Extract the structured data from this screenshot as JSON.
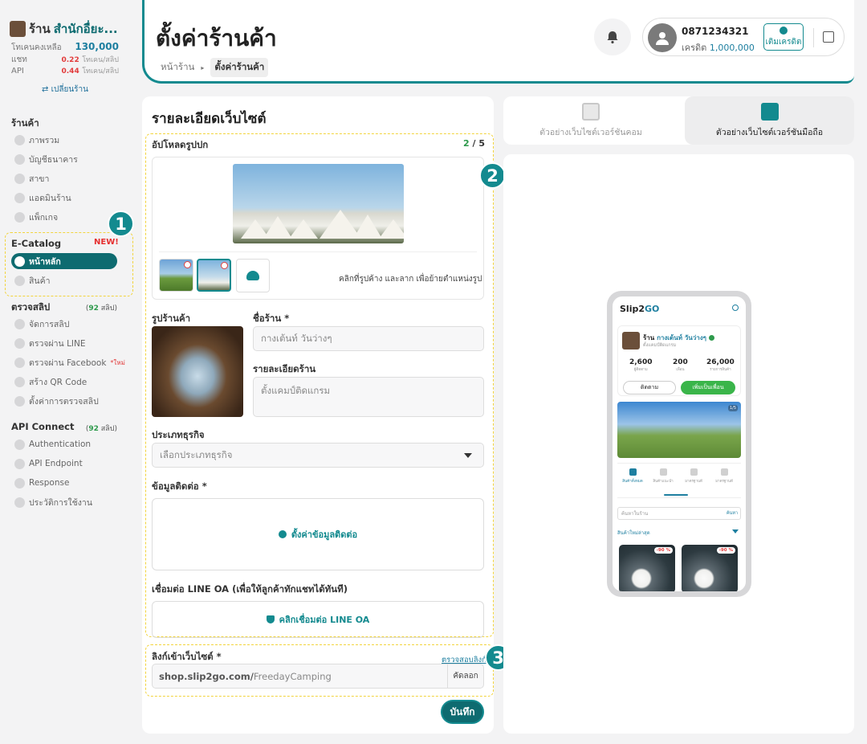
{
  "sidebar": {
    "shop_prefix": "ร้าน",
    "shop_name": "สำนักอื่ยะ...",
    "token_label": "โทเคนคงเหลือ",
    "token_value": "130,000",
    "chat_label": "แชท",
    "chat_rate": "0.22",
    "chat_unit": "โทเคน/สลิป",
    "api_label": "API",
    "api_rate": "0.44",
    "api_unit": "โทเคน/สลิป",
    "switch_shop": "⇄ เปลี่ยนร้าน",
    "section_shop": "ร้านค้า",
    "shop_items": [
      "ภาพรวม",
      "บัญชีธนาคาร",
      "สาขา",
      "แอดมินร้าน",
      "แพ็กเกจ"
    ],
    "section_ecatalog": "E-Catalog",
    "new_badge": "NEW!",
    "ecatalog_items": [
      "หน้าหลัก",
      "สินค้า"
    ],
    "section_verify": "ตรวจสลิป",
    "verify_count_prefix": "(",
    "verify_count": "92",
    "verify_count_suffix": "สลิป)",
    "verify_items": [
      "จัดการสลิป",
      "ตรวจผ่าน LINE",
      "ตรวจผ่าน Facebook",
      "สร้าง QR Code",
      "ตั้งค่าการตรวจสลิป"
    ],
    "facebook_new": "*ใหม่",
    "section_api": "API Connect",
    "api_count": "92",
    "api_items": [
      "Authentication",
      "API Endpoint",
      "Response",
      "ประวัติการใช้งาน"
    ]
  },
  "badges": {
    "one": "1",
    "two": "2",
    "three": "3"
  },
  "header": {
    "title": "ตั้งค่าร้านค้า",
    "crumb_home": "หน้าร้าน",
    "crumb_sep": "▸",
    "crumb_current": "ตั้งค่าร้านค้า",
    "phone": "0871234321",
    "credit_label": "เครดิต",
    "credit_value": "1,000,000",
    "topup_label": "เติมเครดิต"
  },
  "form": {
    "panel_title": "รายละเอียดเว็บไซต์",
    "cover_label": "อัปโหลดรูปปก",
    "cover_count": "2",
    "cover_max": "/ 5",
    "drag_hint": "คลิกที่รูปค้าง และลาก เพื่อย้ายตำแหน่งรูป",
    "shop_image_label": "รูปร้านค้า",
    "shop_name_label": "ชื่อร้าน *",
    "shop_name_placeholder": "กางเต้นท์ วันว่างๆ",
    "shop_detail_label": "รายละเอียดร้าน",
    "shop_detail_value": "ตั้งแคมป์ติดแกรม",
    "biz_type_label": "ประเภทธุรกิจ",
    "biz_type_placeholder": "เลือกประเภทธุรกิจ",
    "contact_label": "ข้อมูลติดต่อ *",
    "contact_button": "ตั้งค่าข้อมูลติดต่อ",
    "line_label": "เชื่อมต่อ LINE OA (เพื่อให้ลูกค้าทักแชทได้ทันที)",
    "line_button": "คลิกเชื่อมต่อ LINE OA",
    "link_label": "ลิงก์เข้าเว็บไซต์ *",
    "verify_link": "ตรวจสอบลิงก์",
    "url_domain": "shop.slip2go.com/",
    "url_slug": "FreedayCamping",
    "copy_label": "คัดลอก",
    "save_label": "บันทึก"
  },
  "preview_tabs": {
    "desktop": "ตัวอย่างเว็บไซต์เวอร์ชันคอม",
    "mobile": "ตัวอย่างเว็บไซต์เวอร์ชันมือถือ"
  },
  "phone_preview": {
    "logo_a": "Slip2",
    "logo_b": "GO",
    "shop_prefix": "ร้าน",
    "shop_name": "กางเต้นท์ วันว่างๆ",
    "shop_desc": "ตั้งแคมป์ติดแกรม",
    "stats": [
      {
        "value": "2,600",
        "label": "ผู้ติดตาม"
      },
      {
        "value": "200",
        "label": "เพื่อน"
      },
      {
        "value": "26,000",
        "label": "รายการสินค้า"
      }
    ],
    "follow": "ติดตาม",
    "add_friend": "เพิ่มเป็นเพื่อน",
    "banner_page": "1/5",
    "cats": [
      "สินค้าทั้งหมด",
      "สินค้าแนะนำ",
      "มาตรฐานดี",
      "มาตรฐานดี"
    ],
    "search_placeholder": "ค้นหาในร้าน",
    "search_button": "ค้นหา",
    "new_products": "สินค้าใหม่ล่าสุด",
    "discount_1": "-90 %",
    "discount_2": "-90 %"
  },
  "colors": {
    "accent": "#0e6b70",
    "teal": "#138a8f",
    "blue": "#1e7fa0",
    "red": "#e23b3b",
    "green": "#2e9a4c",
    "highlight": "#f2d43e"
  }
}
